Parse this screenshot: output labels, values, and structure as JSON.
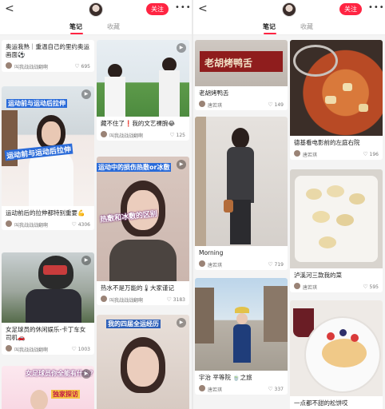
{
  "screens": [
    {
      "header": {
        "back": "<",
        "follow": "关注",
        "more": "•••"
      },
      "tabs": {
        "notes": "笔记",
        "saved": "收藏"
      },
      "cards": [
        {
          "title": "奥运我熟｜重温自己的里约奥运画面⚽",
          "author": "叫我战战战翻啊",
          "likes": "695"
        },
        {
          "title": "运动前后的拉伸都特别重要💪",
          "author": "叫我战战战翻啊",
          "likes": "4306",
          "overlay": [
            "运动前与运动后拉伸",
            "运动前与运动后拉伸"
          ]
        },
        {
          "title": "女足球员的休闲娱乐-卡丁车女司机🚗",
          "author": "叫我战战战翻啊",
          "likes": "1003"
        },
        {
          "title": "",
          "author": "",
          "likes": "",
          "overlay": [
            "女足球员你全能有什么？",
            "独家探访"
          ]
        },
        {
          "title": "藏不住了❗我的文艺裸腕😂",
          "author": "叫我战战战翻啊",
          "likes": "125"
        },
        {
          "title": "热水不是万能的🌡大家谨记",
          "author": "叫我战战战翻啊",
          "likes": "3183",
          "overlay": [
            "运动中的损伤热敷or冰敷",
            "热敷和冰敷的区别"
          ]
        },
        {
          "title": "",
          "author": "",
          "likes": "",
          "overlay": [
            "我的四届全运经历"
          ]
        }
      ]
    },
    {
      "header": {
        "back": "<",
        "follow": "关注",
        "more": "•••"
      },
      "tabs": {
        "notes": "笔记",
        "saved": "收藏"
      },
      "cards": [
        {
          "title": "老胡烤鸭舌",
          "author": "唐若琪",
          "likes": "149",
          "sign": "老胡烤鸭舌"
        },
        {
          "title": "Morning",
          "author": "唐若琪",
          "likes": "719"
        },
        {
          "title": "宇治 平等院 🍵之旅",
          "author": "唐若琪",
          "likes": "337"
        },
        {
          "title": "德基看电影前的左庭右院",
          "author": "唐若琪",
          "likes": "196"
        },
        {
          "title": "泸溪河三款我的菜",
          "author": "唐若琪",
          "likes": "595"
        },
        {
          "title": "一点都不甜的松饼哎",
          "author": "",
          "likes": ""
        }
      ]
    }
  ],
  "colors": {
    "accent": "#ff2442"
  }
}
